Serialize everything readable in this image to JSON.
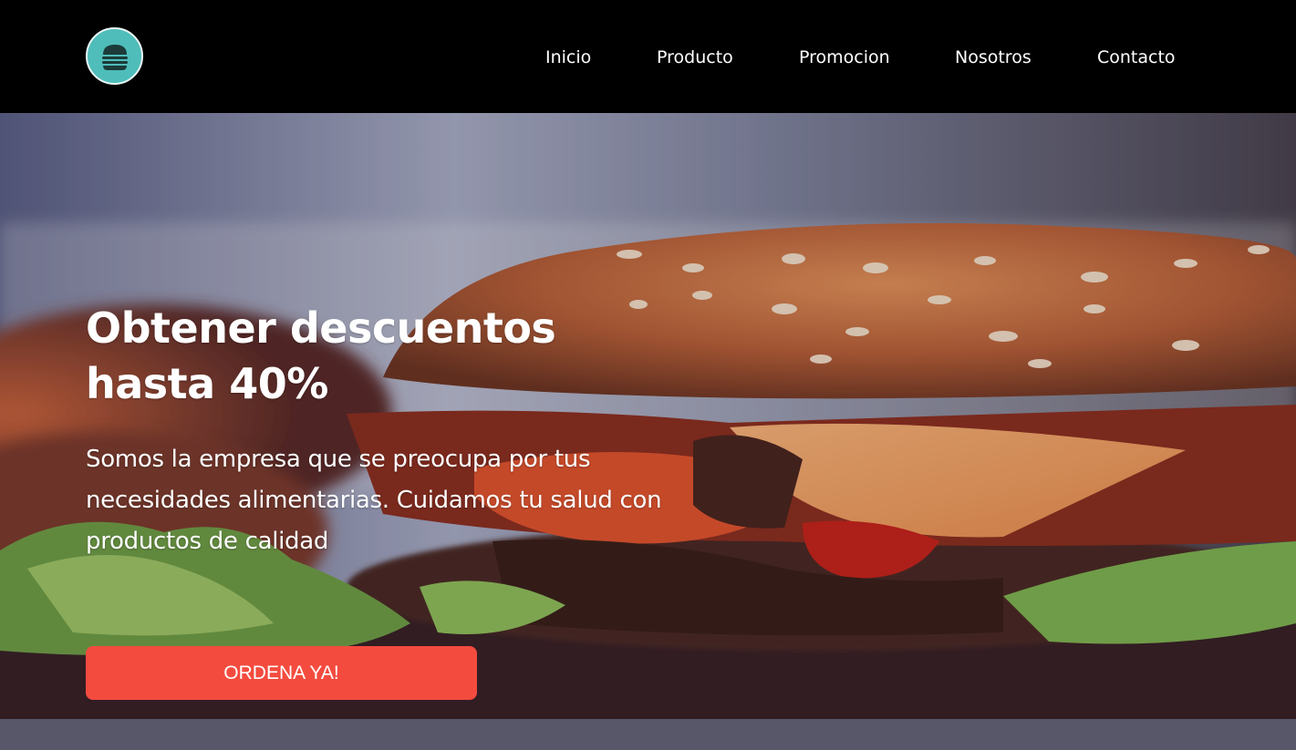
{
  "header": {
    "logo_icon": "burger-icon",
    "logo_color": "#4fbdba",
    "nav": [
      {
        "label": "Inicio"
      },
      {
        "label": "Producto"
      },
      {
        "label": "Promocion"
      },
      {
        "label": "Nosotros"
      },
      {
        "label": "Contacto"
      }
    ]
  },
  "hero": {
    "title": "Obtener descuentos hasta 40%",
    "description": "Somos la empresa que se preocupa por tus necesidades alimentarias. Cuidamos tu salud con productos de calidad",
    "cta_label": "ORDENA YA!",
    "cta_color": "#f44b3f",
    "background_image": "burger-photo"
  }
}
